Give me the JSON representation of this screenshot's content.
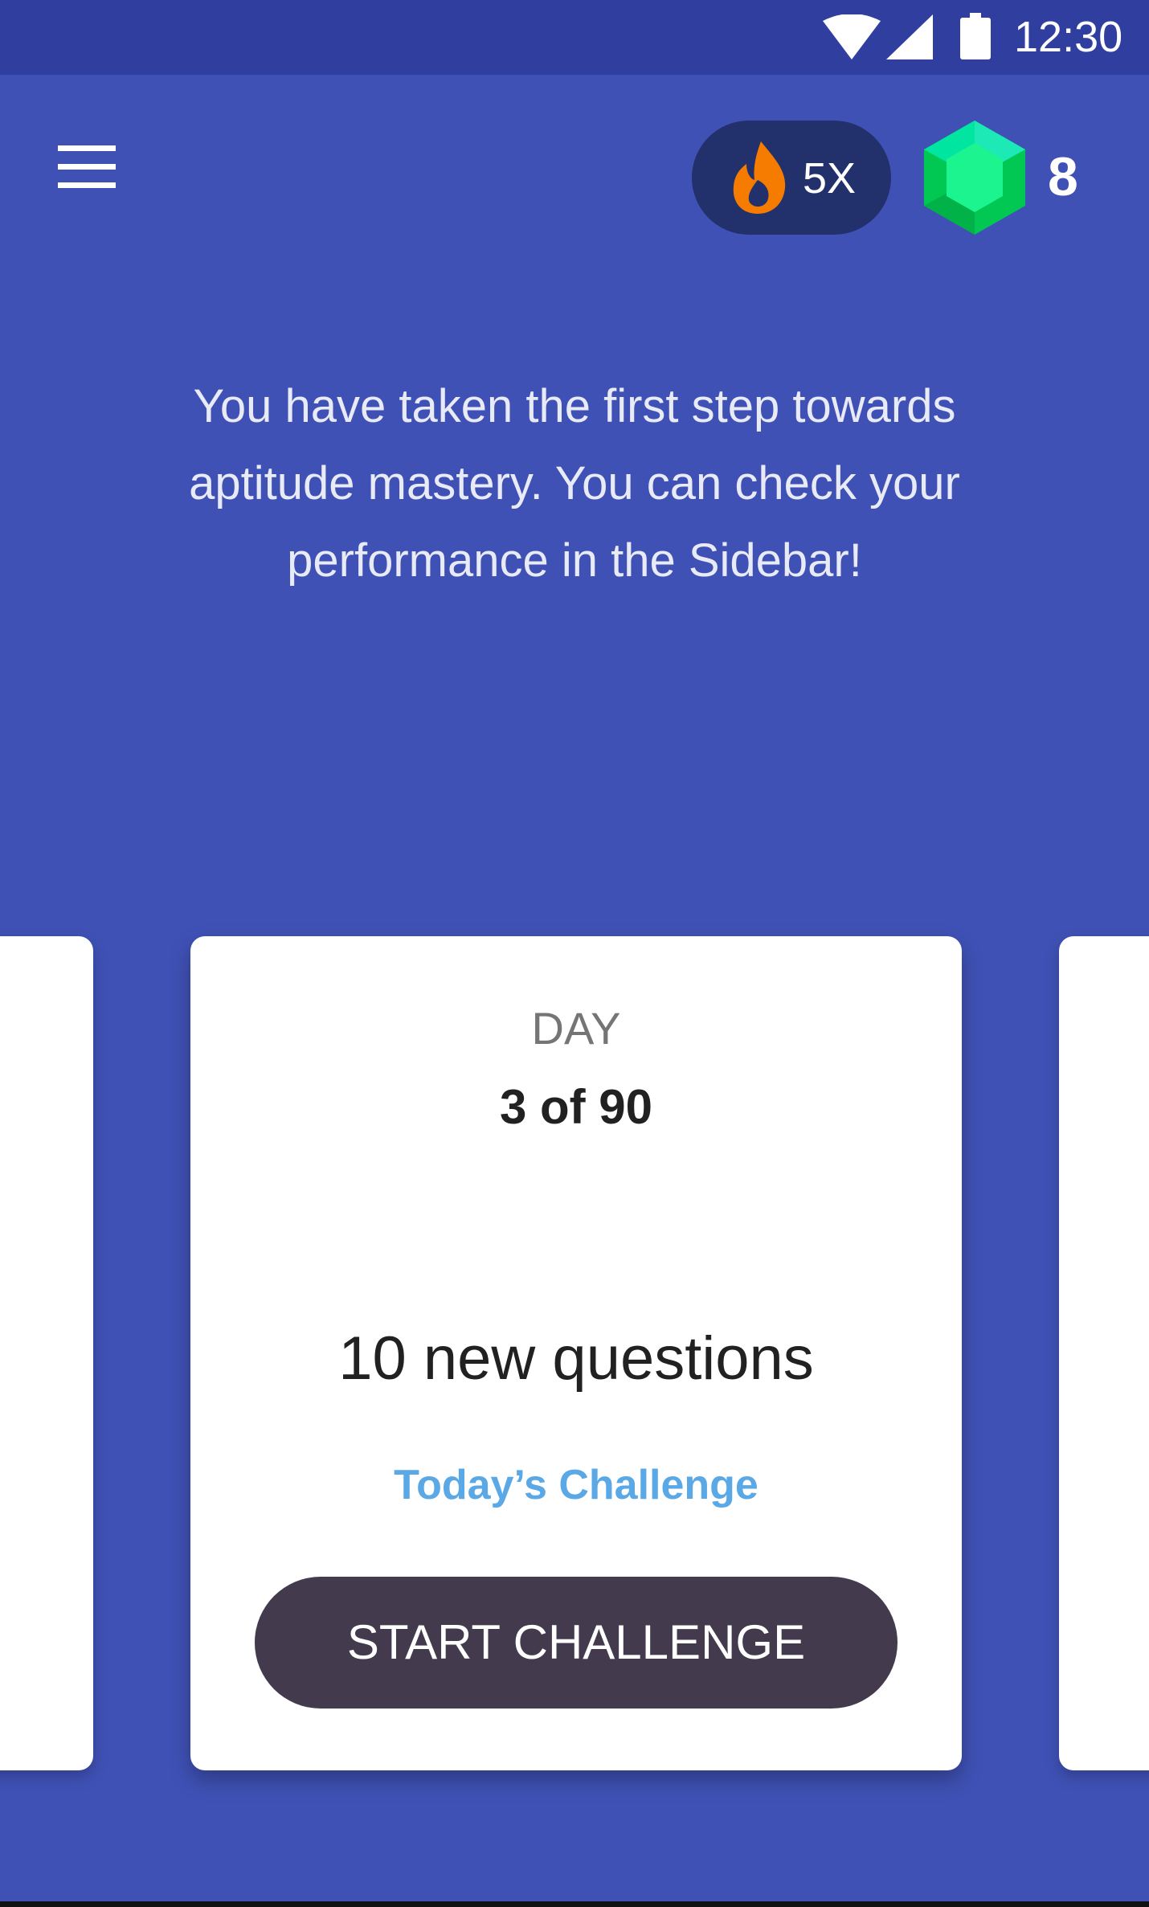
{
  "status_bar": {
    "time": "12:30",
    "icons": [
      "wifi-icon",
      "signal-icon",
      "battery-icon"
    ]
  },
  "header": {
    "menu_icon": "hamburger-menu-icon",
    "streak": {
      "icon": "flame-icon",
      "label": "5X"
    },
    "gems": {
      "icon": "gem-icon",
      "count": "8"
    }
  },
  "intro": {
    "message": "You have taken the first step towards aptitude mastery. You can check your performance in the Sidebar!"
  },
  "challenge_card": {
    "day_label": "DAY",
    "day_progress": "3 of 90",
    "questions": "10 new questions",
    "subtitle": "Today’s Challenge",
    "button_label": "START CHALLENGE"
  },
  "colors": {
    "background": "#3f51b5",
    "status_bar": "#303f9f",
    "streak_pill": "#22306b",
    "flame": "#f57c00",
    "gem": "#1de9b6",
    "accent_text": "#5aa9e6",
    "button": "#433a4d"
  }
}
